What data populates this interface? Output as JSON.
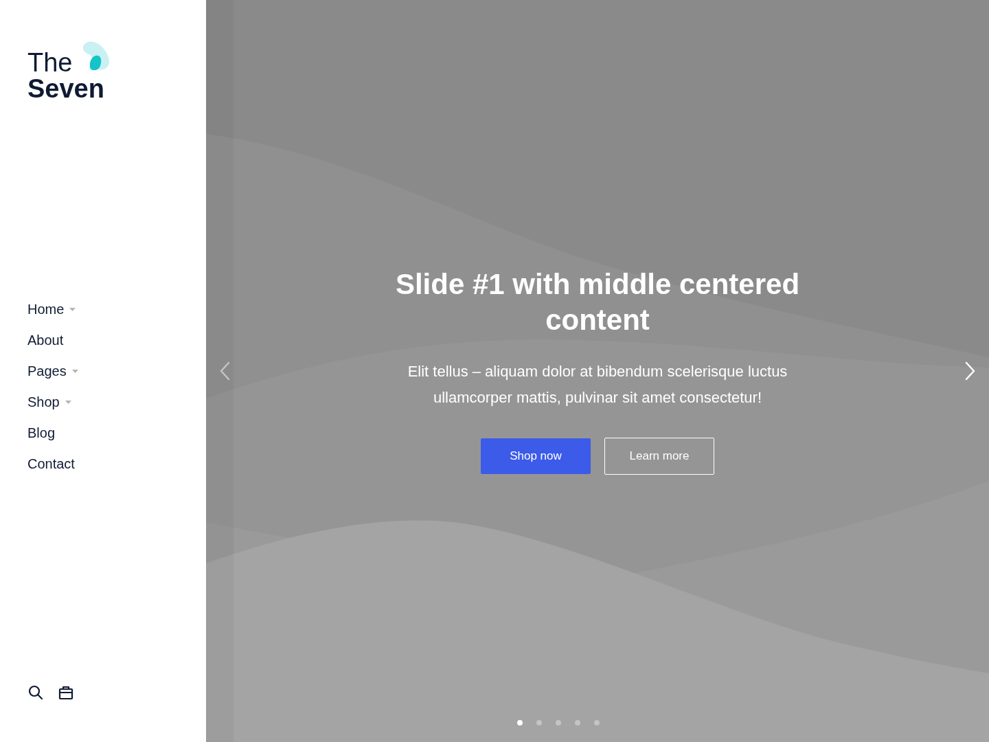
{
  "logo": {
    "line1": "The",
    "line2": "Seven"
  },
  "nav": [
    {
      "label": "Home",
      "dropdown": true
    },
    {
      "label": "About",
      "dropdown": false
    },
    {
      "label": "Pages",
      "dropdown": true
    },
    {
      "label": "Shop",
      "dropdown": true
    },
    {
      "label": "Blog",
      "dropdown": false
    },
    {
      "label": "Contact",
      "dropdown": false
    }
  ],
  "slide": {
    "title": "Slide #1 with middle centered content",
    "text": "Elit tellus – aliquam dolor at bibendum scelerisque luctus ullamcorper mattis, pulvinar sit amet consectetur!",
    "buttons": [
      {
        "label": "Shop now",
        "kind": "primary"
      },
      {
        "label": "Learn more",
        "kind": "outline"
      }
    ]
  },
  "dots": [
    {
      "selected": true
    },
    {
      "selected": false
    },
    {
      "selected": false
    },
    {
      "selected": false
    },
    {
      "selected": false
    }
  ]
}
